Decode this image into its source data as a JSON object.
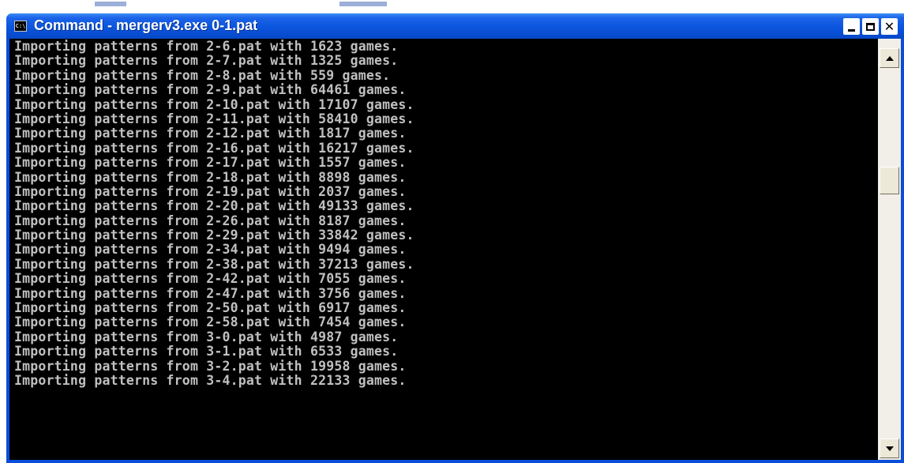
{
  "window": {
    "title": "Command - mergerv3.exe 0-1.pat",
    "icon": "console-icon",
    "icon_text": "C:\\"
  },
  "console": {
    "lines": [
      "Importing patterns from 2-6.pat with 1623 games.",
      "Importing patterns from 2-7.pat with 1325 games.",
      "Importing patterns from 2-8.pat with 559 games.",
      "Importing patterns from 2-9.pat with 64461 games.",
      "Importing patterns from 2-10.pat with 17107 games.",
      "Importing patterns from 2-11.pat with 58410 games.",
      "Importing patterns from 2-12.pat with 1817 games.",
      "Importing patterns from 2-16.pat with 16217 games.",
      "Importing patterns from 2-17.pat with 1557 games.",
      "Importing patterns from 2-18.pat with 8898 games.",
      "Importing patterns from 2-19.pat with 2037 games.",
      "Importing patterns from 2-20.pat with 49133 games.",
      "Importing patterns from 2-26.pat with 8187 games.",
      "Importing patterns from 2-29.pat with 33842 games.",
      "Importing patterns from 2-34.pat with 9494 games.",
      "Importing patterns from 2-38.pat with 37213 games.",
      "Importing patterns from 2-42.pat with 7055 games.",
      "Importing patterns from 2-47.pat with 3756 games.",
      "Importing patterns from 2-50.pat with 6917 games.",
      "Importing patterns from 2-58.pat with 7454 games.",
      "Importing patterns from 3-0.pat with 4987 games.",
      "Importing patterns from 3-1.pat with 6533 games.",
      "Importing patterns from 3-2.pat with 19958 games.",
      "Importing patterns from 3-4.pat with 22133 games."
    ],
    "text_color": "#c0c0c0",
    "background": "#000000"
  },
  "colors": {
    "titlebar": "#0a55dd",
    "frame": "#0a4dd8"
  }
}
